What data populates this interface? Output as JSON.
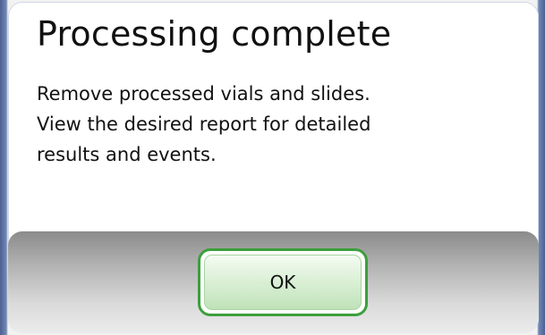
{
  "dialog": {
    "title": "Processing complete",
    "message_lines": [
      "Remove processed vials and slides.",
      "View the desired report for detailed",
      "results and events."
    ],
    "ok_label": "OK"
  },
  "colors": {
    "window_frame": "#5a6f9a",
    "dialog_background": "#ffffff",
    "ok_button_border": "#3c9f3c",
    "ok_button_fill": "#d7eed2"
  }
}
